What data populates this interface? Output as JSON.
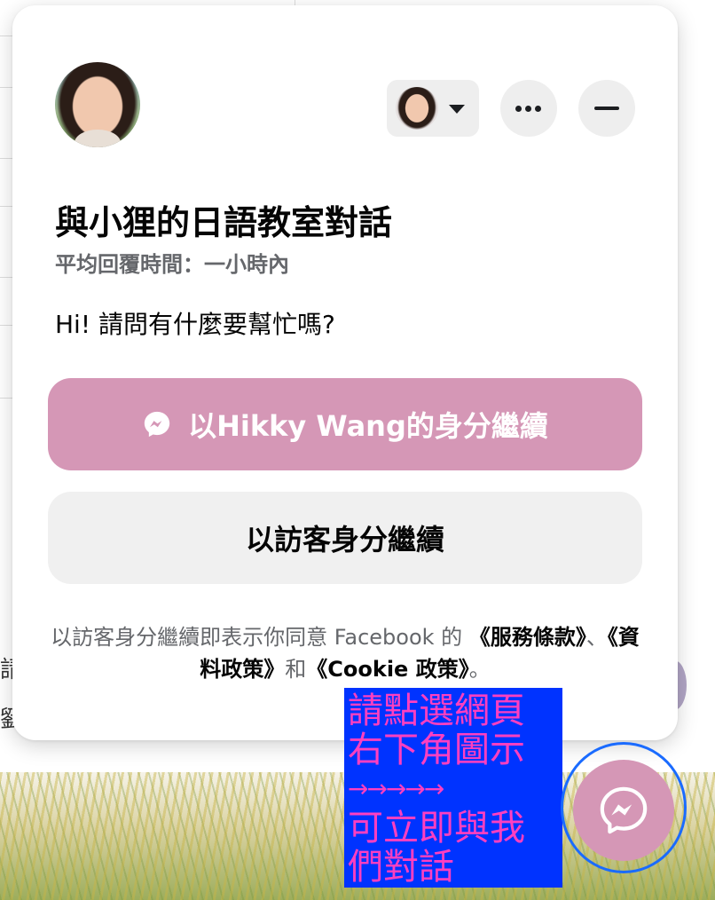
{
  "chat": {
    "title": "與小狸的日語教室對話",
    "response_time": "平均回覆時間：一小時內",
    "greeting": "Hi! 請問有什麼要幫忙嗎?",
    "continue_as_user": "以Hikky Wang的身分繼續",
    "continue_as_guest": "以訪客身分繼續",
    "terms": {
      "prefix": "以訪客身分繼續即表示你同意 Facebook 的",
      "terms_link": "《服務條款》",
      "sep1": "、",
      "data_policy_link": "《資料政策》",
      "and": "和",
      "cookie_policy_link": "《Cookie 政策》",
      "end": "。"
    }
  },
  "note": {
    "line1": "請點選網頁",
    "line2": "右下角圖示",
    "arrows": "→→→→→",
    "line3": "可立即與我",
    "line4": "們對話"
  },
  "background": {
    "char1": "請",
    "char2": "劉"
  },
  "icons": {
    "messenger": "messenger-icon",
    "caret": "caret-down-icon",
    "more": "more-horizontal-icon",
    "minimize": "minimize-icon"
  },
  "colors": {
    "accent": "#d597b6",
    "note_bg": "#0033ff",
    "note_text": "#ff3fc0",
    "launcher_ring": "#1a6bff"
  }
}
